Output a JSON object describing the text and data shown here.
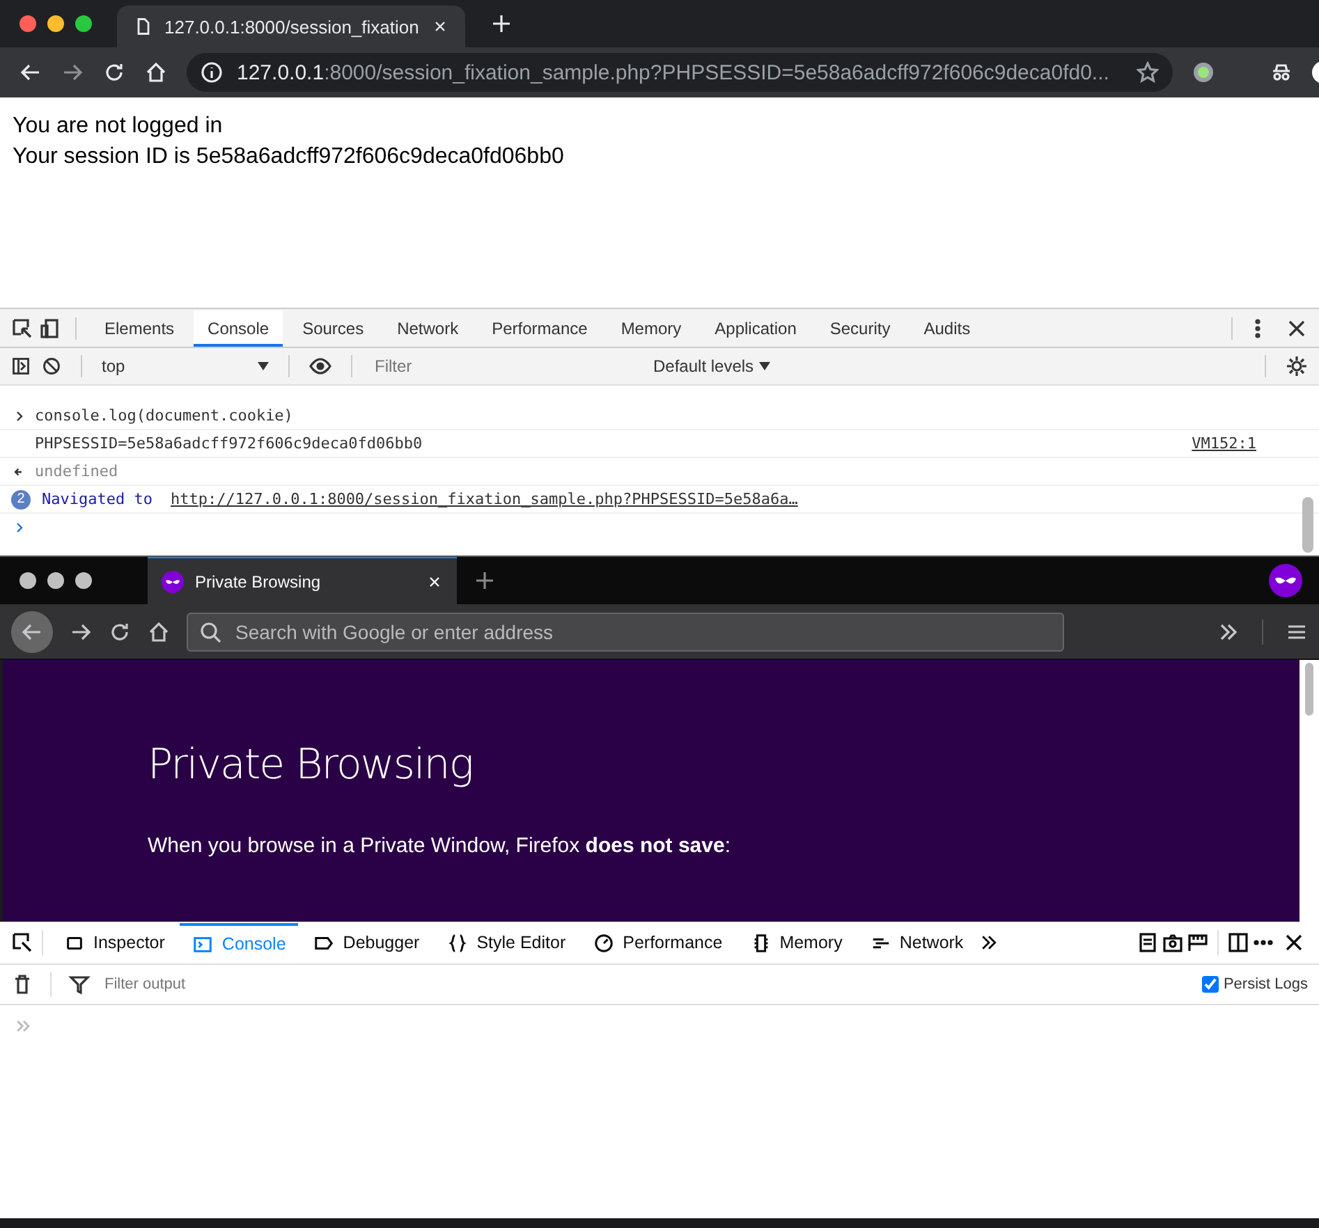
{
  "chrome": {
    "tab": {
      "title": "127.0.0.1:8000/session_fixation"
    },
    "address": {
      "host": "127.0.0.1",
      "rest": ":8000/session_fixation_sample.php?PHPSESSID=5e58a6adcff972f606c9deca0fd0..."
    },
    "page_lines": [
      "You are not logged in",
      "Your session ID is 5e58a6adcff972f606c9deca0fd06bb0"
    ],
    "devtools": {
      "tabs": [
        {
          "label": "Elements",
          "selected": false
        },
        {
          "label": "Console",
          "selected": true
        },
        {
          "label": "Sources",
          "selected": false
        },
        {
          "label": "Network",
          "selected": false
        },
        {
          "label": "Performance",
          "selected": false
        },
        {
          "label": "Memory",
          "selected": false
        },
        {
          "label": "Application",
          "selected": false
        },
        {
          "label": "Security",
          "selected": false
        },
        {
          "label": "Audits",
          "selected": false
        }
      ],
      "context": "top",
      "filter_placeholder": "Filter",
      "levels": "Default levels",
      "console": [
        {
          "kind": "input",
          "text": "console.log(document.cookie)"
        },
        {
          "kind": "output",
          "text": "PHPSESSID=5e58a6adcff972f606c9deca0fd06bb0",
          "source": "VM152:1"
        },
        {
          "kind": "result",
          "text": "undefined"
        },
        {
          "kind": "navigation",
          "count": "2",
          "label": "Navigated to",
          "url": "http://127.0.0.1:8000/session_fixation_sample.php?PHPSESSID=5e58a6a…"
        },
        {
          "kind": "prompt"
        }
      ]
    }
  },
  "firefox": {
    "tab": {
      "title": "Private Browsing"
    },
    "search_placeholder": "Search with Google or enter address",
    "page": {
      "heading": "Private Browsing",
      "text": "When you browse in a Private Window, Firefox **does not save**:"
    },
    "devtools": {
      "tabs": [
        {
          "label": "Inspector",
          "selected": false
        },
        {
          "label": "Console",
          "selected": true
        },
        {
          "label": "Debugger",
          "selected": false
        },
        {
          "label": "Style Editor",
          "selected": false
        },
        {
          "label": "Performance",
          "selected": false
        },
        {
          "label": "Memory",
          "selected": false
        },
        {
          "label": "Network",
          "selected": false
        }
      ],
      "filter_placeholder": "Filter output",
      "persist": {
        "label": "Persist Logs",
        "checked": true
      }
    }
  }
}
